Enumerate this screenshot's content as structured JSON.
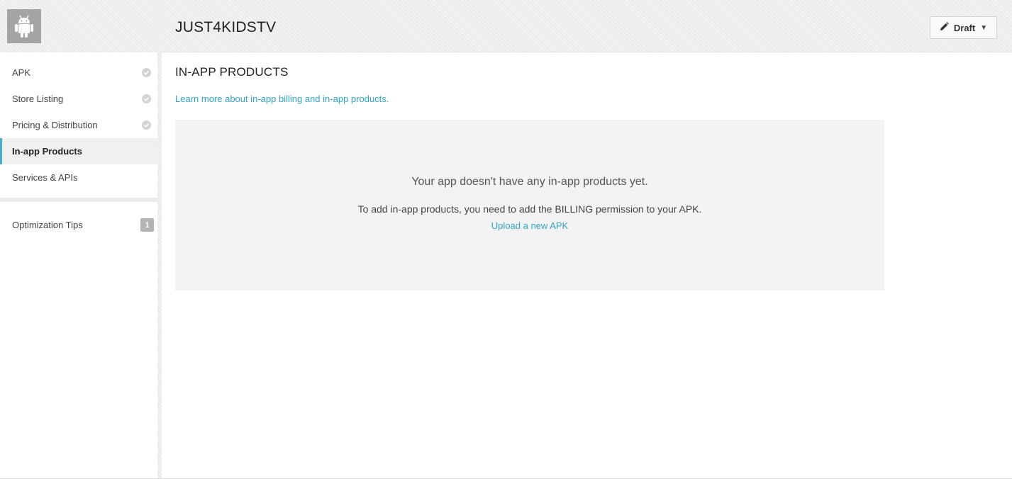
{
  "app": {
    "name": "JUST4KIDSTV",
    "icon": "android-icon"
  },
  "header": {
    "status_button": {
      "label": "Draft",
      "icon": "pencil-icon",
      "caret_icon": "caret-down-icon"
    }
  },
  "sidebar": {
    "items": [
      {
        "label": "APK",
        "complete": true
      },
      {
        "label": "Store Listing",
        "complete": true
      },
      {
        "label": "Pricing & Distribution",
        "complete": true
      },
      {
        "label": "In-app Products",
        "active": true
      },
      {
        "label": "Services & APIs"
      }
    ],
    "optimization_tips": {
      "label": "Optimization Tips",
      "count": "1"
    }
  },
  "main": {
    "title": "IN-APP PRODUCTS",
    "learn_link": "Learn more about in-app billing and in-app products.",
    "empty_state": {
      "heading": "Your app doesn't have any in-app products yet.",
      "message": "To add in-app products, you need to add the BILLING permission to your APK.",
      "action_link": "Upload a new APK"
    }
  },
  "colors": {
    "accent": "#33a3c1",
    "active_border": "#4cadc5",
    "badge": "#b4b4b4",
    "panel": "#f3f3f3"
  }
}
